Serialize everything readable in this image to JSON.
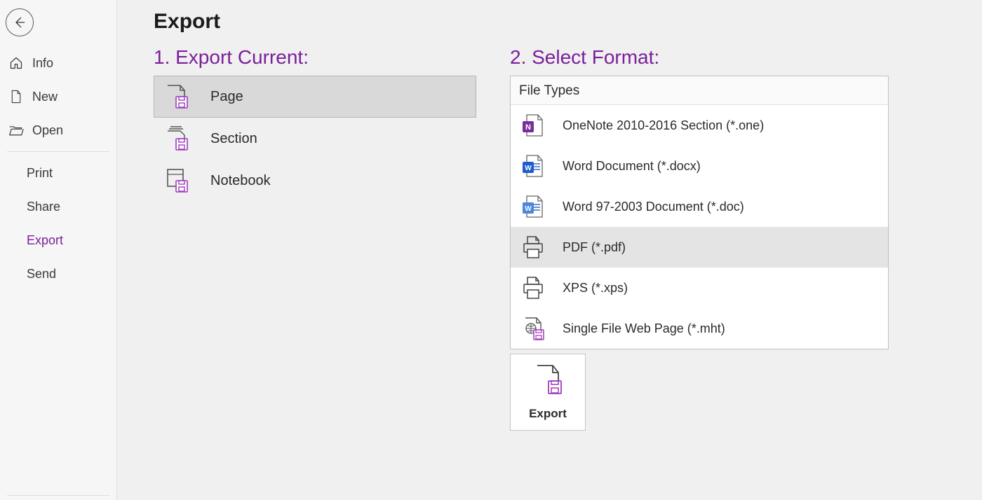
{
  "sidebar": {
    "items": [
      {
        "label": "Info"
      },
      {
        "label": "New"
      },
      {
        "label": "Open"
      },
      {
        "label": "Print"
      },
      {
        "label": "Share"
      },
      {
        "label": "Export"
      },
      {
        "label": "Send"
      }
    ]
  },
  "page_title": "Export",
  "section1_heading": "1. Export Current:",
  "export_current": [
    {
      "label": "Page",
      "selected": true
    },
    {
      "label": "Section",
      "selected": false
    },
    {
      "label": "Notebook",
      "selected": false
    }
  ],
  "section2_heading": "2. Select Format:",
  "file_types_header": "File Types",
  "formats": [
    {
      "label": "OneNote 2010-2016 Section (*.one)",
      "selected": false
    },
    {
      "label": "Word Document (*.docx)",
      "selected": false
    },
    {
      "label": "Word 97-2003 Document (*.doc)",
      "selected": false
    },
    {
      "label": "PDF (*.pdf)",
      "selected": true
    },
    {
      "label": "XPS (*.xps)",
      "selected": false
    },
    {
      "label": "Single File Web Page (*.mht)",
      "selected": false
    }
  ],
  "export_button_label": "Export",
  "colors": {
    "accent": "#7a1f9b"
  }
}
